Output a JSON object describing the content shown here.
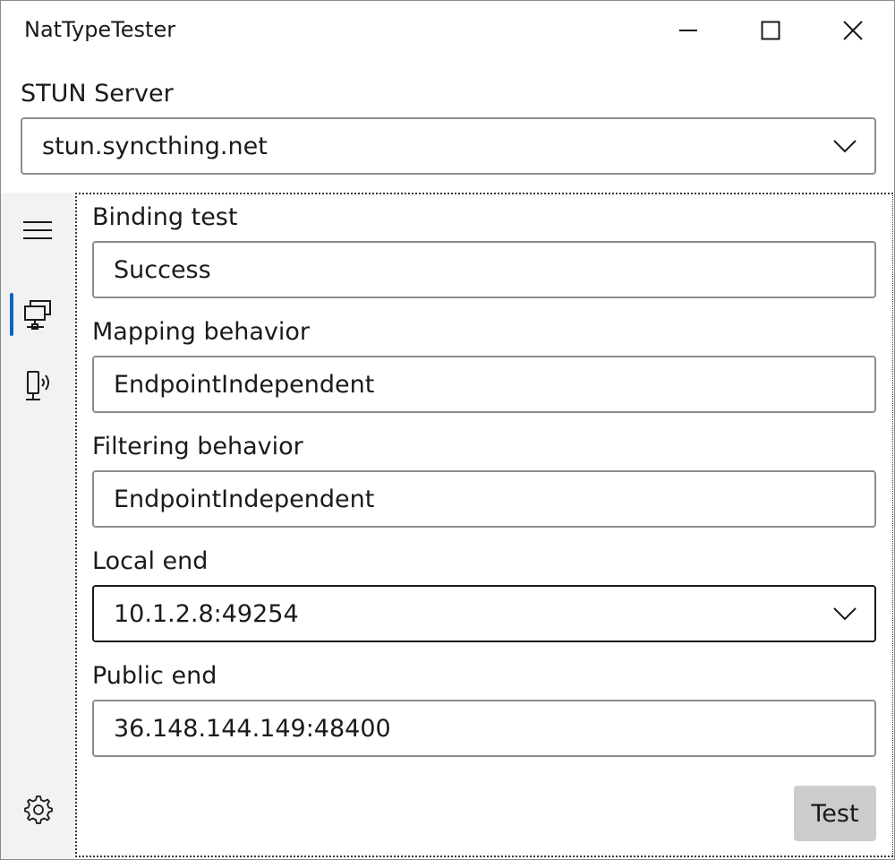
{
  "window": {
    "title": "NatTypeTester",
    "caption_buttons": [
      "minimize-icon",
      "maximize-icon",
      "close-icon"
    ]
  },
  "stun": {
    "label": "STUN Server",
    "selected": "stun.syncthing.net"
  },
  "nav": {
    "items": [
      {
        "icon": "hamburger-menu-icon",
        "selected": false
      },
      {
        "icon": "network-computer-icon",
        "selected": true
      },
      {
        "icon": "broadcast-device-icon",
        "selected": false
      }
    ],
    "footer_icon": "gear-icon",
    "accent": "#0a64c8"
  },
  "results": {
    "binding": {
      "label": "Binding test",
      "value": "Success"
    },
    "mapping": {
      "label": "Mapping behavior",
      "value": "EndpointIndependent"
    },
    "filtering": {
      "label": "Filtering behavior",
      "value": "EndpointIndependent"
    },
    "local": {
      "label": "Local end",
      "value": "10.1.2.8:49254"
    },
    "public": {
      "label": "Public end",
      "value": "36.148.144.149:48400"
    }
  },
  "actions": {
    "test_label": "Test"
  }
}
